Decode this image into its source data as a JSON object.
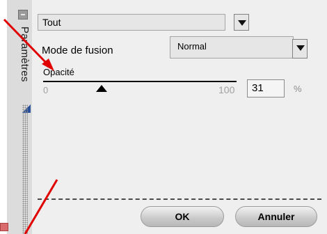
{
  "sidebar": {
    "title": "Paramètres"
  },
  "top_dropdown": {
    "value": "Tout"
  },
  "blend": {
    "label": "Mode de fusion",
    "value": "Normal"
  },
  "opacity": {
    "label": "Opacité",
    "min": "0",
    "max": "100",
    "value": "31",
    "unit": "%",
    "level": 0.31
  },
  "buttons": {
    "ok": "OK",
    "cancel": "Annuler"
  },
  "annotation_color": "#e00000"
}
